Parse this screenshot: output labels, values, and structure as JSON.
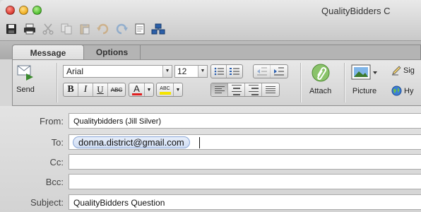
{
  "window": {
    "title": "QualityBidders C"
  },
  "quick_toolbar": {
    "icons": [
      "save-icon",
      "print-icon",
      "cut-icon",
      "copy-icon",
      "paste-icon",
      "undo-icon",
      "redo-icon",
      "document-icon",
      "network-icon"
    ]
  },
  "ribbon": {
    "tabs": [
      {
        "label": "Message",
        "active": true
      },
      {
        "label": "Options",
        "active": false
      }
    ],
    "send_label": "Send",
    "font_name": "Arial",
    "font_size": "12",
    "bold": "B",
    "italic": "I",
    "underline": "U",
    "strike": "ABC",
    "font_color": "A",
    "highlight": "ABC",
    "attach_label": "Attach",
    "picture_label": "Picture",
    "signature_label": "Sig",
    "hyperlink_label": "Hy"
  },
  "fields": {
    "from_label": "From:",
    "from_value": "Qualitybidders (Jill Silver)",
    "to_label": "To:",
    "to_recipient": "donna.district@gmail.com",
    "cc_label": "Cc:",
    "bcc_label": "Bcc:",
    "subject_label": "Subject:",
    "subject_value": "QualityBidders Question"
  },
  "colors": {
    "font_color_bar": "#e02020",
    "highlight_bar": "#f5e400",
    "chip_border": "#8aa6d6"
  }
}
